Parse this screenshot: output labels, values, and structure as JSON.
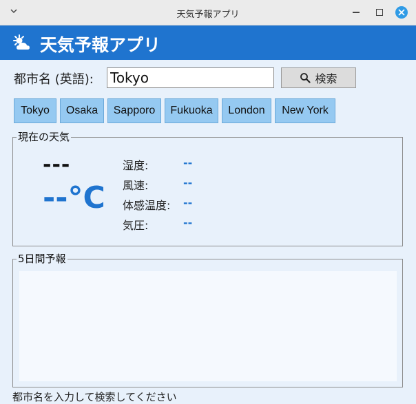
{
  "window": {
    "title": "天気予報アプリ"
  },
  "header": {
    "title": "天気予報アプリ",
    "icon": "sun-cloud-icon"
  },
  "search": {
    "label": "都市名 (英語):",
    "value": "Tokyo",
    "button_label": "検索"
  },
  "quick_cities": [
    "Tokyo",
    "Osaka",
    "Sapporo",
    "Fukuoka",
    "London",
    "New York"
  ],
  "current": {
    "section_title": "現在の天気",
    "condition": "---",
    "temperature": "--°C",
    "details": [
      {
        "label": "湿度:",
        "value": "--"
      },
      {
        "label": "風速:",
        "value": "--"
      },
      {
        "label": "体感温度:",
        "value": "--"
      },
      {
        "label": "気圧:",
        "value": "--"
      }
    ]
  },
  "forecast": {
    "section_title": "5日間予報"
  },
  "status": {
    "text": "都市名を入力して検索してください"
  },
  "colors": {
    "accent": "#1f74cf",
    "city_button": "#95c9f1",
    "background": "#e8f1fb"
  }
}
